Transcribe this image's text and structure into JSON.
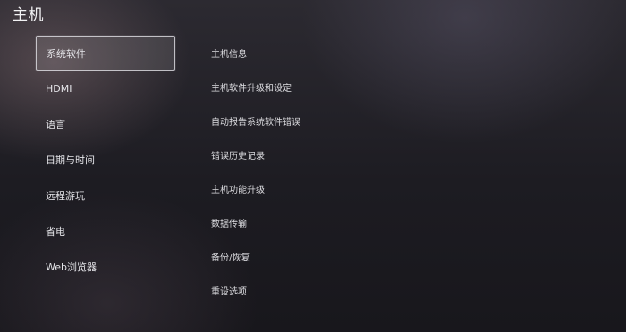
{
  "header": {
    "title": "主机"
  },
  "left_menu": {
    "items": [
      {
        "label": "系统软件",
        "selected": true
      },
      {
        "label": "HDMI",
        "selected": false
      },
      {
        "label": "语言",
        "selected": false
      },
      {
        "label": "日期与时间",
        "selected": false
      },
      {
        "label": "远程游玩",
        "selected": false
      },
      {
        "label": "省电",
        "selected": false
      },
      {
        "label": "Web浏览器",
        "selected": false
      }
    ]
  },
  "right_menu": {
    "items": [
      {
        "label": "主机信息"
      },
      {
        "label": "主机软件升级和设定"
      },
      {
        "label": "自动报告系统软件错误"
      },
      {
        "label": "错误历史记录"
      },
      {
        "label": "主机功能升级"
      },
      {
        "label": "数据传输"
      },
      {
        "label": "备份/恢复"
      },
      {
        "label": "重设选项"
      }
    ]
  }
}
